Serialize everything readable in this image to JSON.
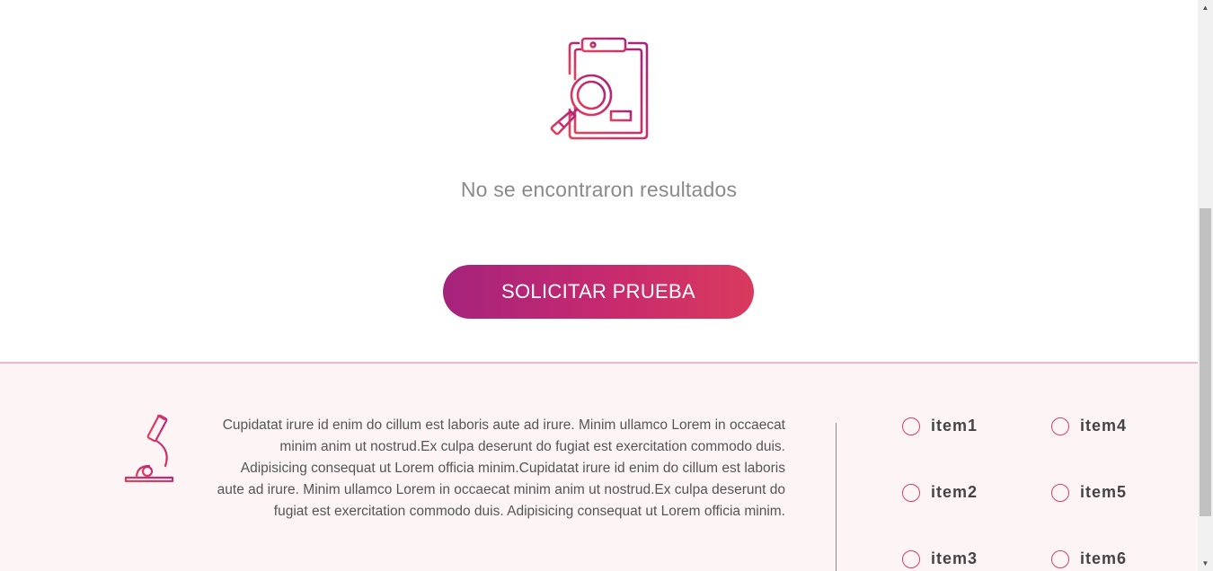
{
  "empty_state": {
    "message": "No se encontraron resultados",
    "button_label": "SOLICITAR PRUEBA",
    "icon": "clipboard-search-icon"
  },
  "footer": {
    "icon": "microscope-icon",
    "description": "Cupidatat irure id enim do cillum est laboris aute ad irure. Minim ullamco Lorem in occaecat minim anim ut nostrud.Ex culpa deserunt do fugiat est exercitation commodo duis. Adipisicing consequat ut Lorem officia minim.Cupidatat irure id enim do cillum est laboris aute ad irure. Minim ullamco Lorem in occaecat minim anim ut nostrud.Ex culpa deserunt do fugiat est exercitation commodo duis. Adipisicing consequat ut Lorem officia minim.",
    "options": [
      {
        "label": "item1",
        "selected": false
      },
      {
        "label": "item2",
        "selected": false
      },
      {
        "label": "item3",
        "selected": false
      },
      {
        "label": "item4",
        "selected": false
      },
      {
        "label": "item5",
        "selected": false
      },
      {
        "label": "item6",
        "selected": false
      }
    ]
  },
  "colors": {
    "accent_start": "#a5237d",
    "accent_end": "#d93a5e",
    "footer_bg": "#fdf4f6",
    "radio_border": "#d2416e"
  }
}
